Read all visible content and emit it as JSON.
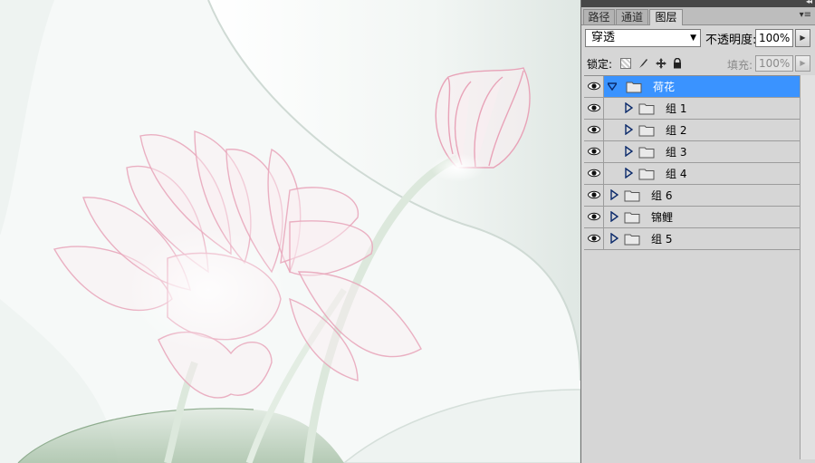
{
  "app": {
    "panel_tabs": [
      {
        "label": "路径",
        "active": false
      },
      {
        "label": "通道",
        "active": false
      },
      {
        "label": "图层",
        "active": true
      }
    ],
    "collapse_glyph": "◂◂",
    "panel_menu_glyph": "▾≡"
  },
  "controls": {
    "blend_mode": "穿透",
    "opacity_label": "不透明度:",
    "opacity_value": "100%",
    "lock_label": "锁定:",
    "lock_icons": [
      "lock-transparent-pixels-icon",
      "lock-image-pixels-icon",
      "lock-position-icon",
      "lock-all-icon"
    ],
    "fill_label": "填充:",
    "fill_value": "100%"
  },
  "layers": [
    {
      "name": "荷花",
      "indent": 0,
      "expanded": true,
      "selected": true,
      "visible": true
    },
    {
      "name": "组 1",
      "indent": 1,
      "expanded": false,
      "selected": false,
      "visible": true
    },
    {
      "name": "组 2",
      "indent": 1,
      "expanded": false,
      "selected": false,
      "visible": true
    },
    {
      "name": "组 3",
      "indent": 1,
      "expanded": false,
      "selected": false,
      "visible": true
    },
    {
      "name": "组 4",
      "indent": 1,
      "expanded": false,
      "selected": false,
      "visible": true
    },
    {
      "name": "组 6",
      "indent": 0,
      "expanded": false,
      "selected": false,
      "visible": true
    },
    {
      "name": "锦鲤",
      "indent": 0,
      "expanded": false,
      "selected": false,
      "visible": true
    },
    {
      "name": "组 5",
      "indent": 0,
      "expanded": false,
      "selected": false,
      "visible": true
    }
  ],
  "colors": {
    "selection": "#3a93ff",
    "panel_bg": "#d6d6d6",
    "petal": "#e8a3b8",
    "leaf": "#a9c2a9"
  }
}
